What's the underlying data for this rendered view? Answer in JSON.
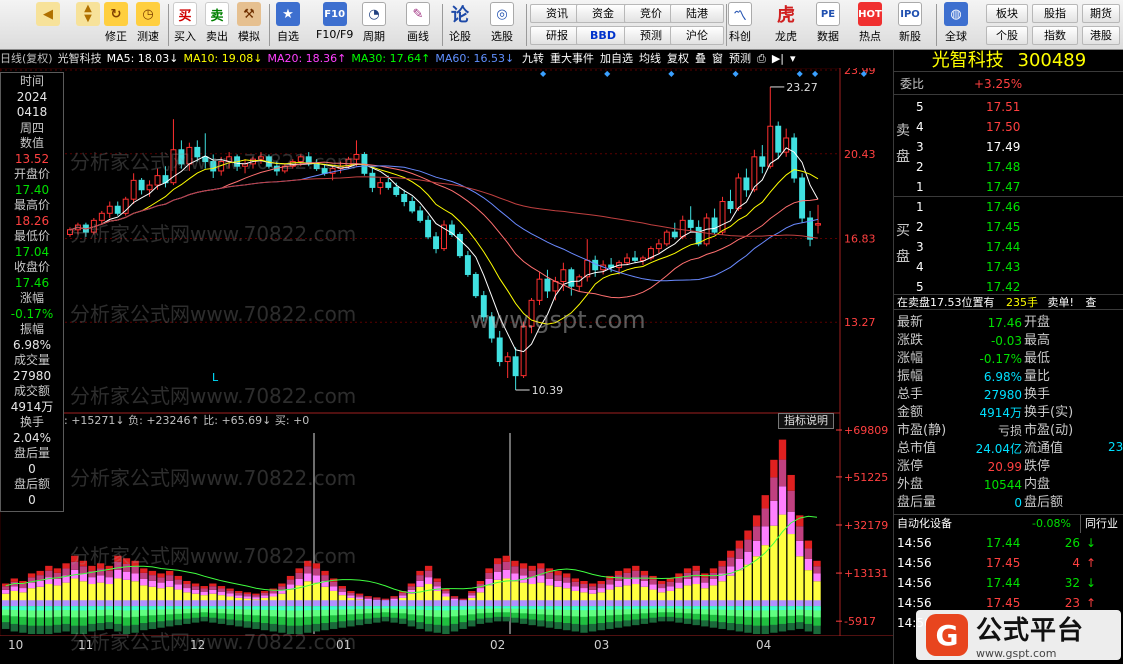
{
  "toolbar": {
    "buttons": [
      {
        "label": "",
        "icon": "back-arrow-icon"
      },
      {
        "label": "",
        "icon": "up-down-arrows-icon"
      },
      {
        "label": "修正",
        "icon": "refresh-icon"
      },
      {
        "label": "测速",
        "icon": "clock-icon"
      },
      {
        "label": "买入",
        "icon": "buy-icon"
      },
      {
        "label": "卖出",
        "icon": "sell-icon"
      },
      {
        "label": "模拟",
        "icon": "hammer-icon"
      },
      {
        "label": "自选",
        "icon": "star-icon"
      },
      {
        "label": "F10/F9",
        "icon": "f10-icon"
      },
      {
        "label": "周期",
        "icon": "period-clock-icon"
      },
      {
        "label": "画线",
        "icon": "pencil-icon"
      },
      {
        "label": "论股",
        "icon": "discuss-icon"
      },
      {
        "label": "选股",
        "icon": "select-stock-icon"
      }
    ],
    "grid_buttons": [
      [
        "资讯",
        "资金",
        "竞价",
        "陆港"
      ],
      [
        "研报",
        "BBD",
        "预测",
        "沪伦"
      ]
    ],
    "right_buttons": [
      {
        "label": "科创",
        "icon": "chart-icon"
      },
      {
        "label": "龙虎",
        "icon": "tiger-icon"
      },
      {
        "label": "数据",
        "icon": "pe-icon"
      },
      {
        "label": "热点",
        "icon": "hot-icon"
      },
      {
        "label": "新股",
        "icon": "new-stock-icon"
      },
      {
        "label": "全球",
        "icon": "globe-icon"
      }
    ],
    "far_right": [
      [
        "板块",
        "股指",
        "期货"
      ],
      [
        "个股",
        "指数",
        "港股"
      ]
    ]
  },
  "header": {
    "chart_mode": "日线(复权)",
    "stock_name": "光智科技",
    "ma5": "MA5: 18.03↓",
    "ma10": "MA10: 19.08↓",
    "ma20": "MA20: 18.36↑",
    "ma30": "MA30: 17.64↑",
    "ma60": "MA60: 16.53↓",
    "tabs": [
      "九转",
      "重大事件",
      "加自选",
      "均线",
      "复权",
      "叠",
      "窗",
      "预测"
    ]
  },
  "left_info": [
    {
      "label": "时间",
      "value": "2024"
    },
    {
      "label": "",
      "value": "0418"
    },
    {
      "label": "周四",
      "value": ""
    },
    {
      "label": "数值",
      "value": "13.52"
    },
    {
      "label": "开盘价",
      "value": "17.40"
    },
    {
      "label": "最高价",
      "value": "18.26"
    },
    {
      "label": "最低价",
      "value": "17.04"
    },
    {
      "label": "收盘价",
      "value": "17.46"
    },
    {
      "label": "涨幅",
      "value": "-0.17%"
    },
    {
      "label": "振幅",
      "value": "6.98%"
    },
    {
      "label": "成交量",
      "value": "27980"
    },
    {
      "label": "成交额",
      "value": "4914万"
    },
    {
      "label": "换手",
      "value": "2.04%"
    },
    {
      "label": "盘后量",
      "value": "0"
    },
    {
      "label": "盘后额",
      "value": "0"
    }
  ],
  "price_axis": [
    "23.99",
    "20.43",
    "16.83",
    "13.27"
  ],
  "annotations": {
    "high": "23.27",
    "low": "10.39",
    "marker": "L"
  },
  "indicator": {
    "header": ": +15271↓ 负: +23246↑ 比: +65.69↓ 买: +0",
    "button": "指标说明",
    "axis": [
      "+69809",
      "+51225",
      "+32179",
      "+13131",
      "-5917"
    ]
  },
  "month_axis": [
    "10",
    "11",
    "12",
    "01",
    "02",
    "03",
    "04"
  ],
  "right_panel": {
    "title": "光智科技",
    "code": "300489",
    "weibi_label": "委比",
    "weibi_value": "+3.25%",
    "sell_label": "卖盘",
    "buy_label": "买盘",
    "sells": [
      {
        "level": "5",
        "price": "17.51"
      },
      {
        "level": "4",
        "price": "17.50"
      },
      {
        "level": "3",
        "price": "17.49"
      },
      {
        "level": "2",
        "price": "17.48"
      },
      {
        "level": "1",
        "price": "17.47"
      }
    ],
    "buys": [
      {
        "level": "1",
        "price": "17.46"
      },
      {
        "level": "2",
        "price": "17.45"
      },
      {
        "level": "3",
        "price": "17.44"
      },
      {
        "level": "4",
        "price": "17.43"
      },
      {
        "level": "5",
        "price": "17.42"
      }
    ],
    "info_bar": "在卖盘17.53位置有",
    "info_bar_qty": "235手",
    "info_bar_btn": "卖单!",
    "info_bar_btn2": "查",
    "stats_left": [
      {
        "label": "最新",
        "value": "17.46"
      },
      {
        "label": "涨跌",
        "value": "-0.03"
      },
      {
        "label": "涨幅",
        "value": "-0.17%"
      },
      {
        "label": "振幅",
        "value": "6.98%"
      },
      {
        "label": "总手",
        "value": "27980"
      },
      {
        "label": "金额",
        "value": "4914万"
      },
      {
        "label": "市盈(静)",
        "value": "亏损"
      },
      {
        "label": "总市值",
        "value": "24.04亿"
      },
      {
        "label": "涨停",
        "value": "20.99"
      },
      {
        "label": "外盘",
        "value": "10544"
      },
      {
        "label": "盘后量",
        "value": "0"
      }
    ],
    "stats_right": [
      "开盘",
      "最高",
      "最低",
      "量比",
      "换手",
      "换手(实)",
      "市盈(动)",
      "流通值",
      "跌停",
      "内盘",
      "盘后额"
    ],
    "stats_right_extra": "23",
    "sector": "自动化设备",
    "sector_change": "-0.08%",
    "sector_btn": "同行业",
    "ticks": [
      {
        "time": "14:56",
        "price": "17.44",
        "vol": "26",
        "dir": "down"
      },
      {
        "time": "14:56",
        "price": "17.45",
        "vol": "4",
        "dir": "up"
      },
      {
        "time": "14:56",
        "price": "17.44",
        "vol": "32",
        "dir": "down"
      },
      {
        "time": "14:56",
        "price": "17.45",
        "vol": "23",
        "dir": "up"
      },
      {
        "time": "14:56",
        "price": "",
        "vol": "",
        "dir": ""
      }
    ]
  },
  "watermarks": {
    "site": "分析家公式网www.70822.com",
    "url": "www.gspt.com"
  },
  "logo": {
    "big": "公式平台",
    "small": "www.gspt.com"
  },
  "colors": {
    "up": "#ff3030",
    "down": "#40e0e0",
    "ma5": "#ffffff",
    "ma10": "#ffff00",
    "ma20": "#ff40ff",
    "ma30": "#00ff00",
    "ma60": "#6090ff"
  },
  "chart_data": {
    "type": "candlestick",
    "ylim": [
      10.39,
      23.99
    ],
    "candles": [
      [
        17.0,
        17.3,
        16.9,
        17.2
      ],
      [
        17.2,
        17.5,
        17.0,
        17.4
      ],
      [
        17.4,
        17.5,
        16.9,
        17.1
      ],
      [
        17.1,
        17.7,
        17.0,
        17.6
      ],
      [
        17.6,
        18.0,
        17.4,
        17.9
      ],
      [
        17.9,
        18.4,
        17.7,
        18.2
      ],
      [
        18.2,
        18.4,
        17.8,
        17.9
      ],
      [
        17.9,
        18.6,
        17.8,
        18.5
      ],
      [
        18.5,
        19.6,
        18.3,
        19.3
      ],
      [
        19.3,
        19.4,
        18.7,
        18.9
      ],
      [
        18.9,
        19.3,
        18.6,
        19.1
      ],
      [
        19.1,
        19.8,
        18.9,
        19.5
      ],
      [
        19.5,
        19.9,
        19.0,
        19.2
      ],
      [
        19.2,
        21.9,
        19.1,
        20.6
      ],
      [
        20.6,
        21.0,
        19.8,
        20.0
      ],
      [
        20.0,
        20.9,
        19.7,
        20.7
      ],
      [
        20.7,
        21.0,
        20.1,
        20.3
      ],
      [
        20.3,
        21.3,
        19.8,
        20.1
      ],
      [
        20.1,
        20.4,
        19.4,
        19.7
      ],
      [
        19.7,
        20.3,
        19.5,
        20.1
      ],
      [
        20.1,
        20.5,
        19.8,
        20.3
      ],
      [
        20.3,
        20.4,
        19.7,
        19.9
      ],
      [
        19.9,
        20.2,
        19.6,
        20.0
      ],
      [
        20.0,
        20.3,
        19.8,
        20.2
      ],
      [
        20.2,
        20.5,
        20.0,
        20.3
      ],
      [
        20.3,
        20.4,
        19.8,
        19.9
      ],
      [
        19.9,
        20.1,
        19.5,
        19.7
      ],
      [
        19.7,
        20.0,
        19.6,
        19.9
      ],
      [
        19.9,
        20.2,
        19.8,
        20.1
      ],
      [
        20.1,
        20.4,
        19.9,
        20.3
      ],
      [
        20.3,
        20.5,
        19.9,
        20.0
      ],
      [
        20.0,
        20.2,
        19.7,
        19.8
      ],
      [
        19.8,
        20.0,
        19.5,
        19.6
      ],
      [
        19.6,
        19.9,
        19.3,
        19.8
      ],
      [
        19.8,
        20.1,
        19.6,
        19.9
      ],
      [
        19.9,
        20.3,
        19.8,
        20.2
      ],
      [
        20.2,
        21.0,
        19.9,
        20.4
      ],
      [
        20.4,
        20.5,
        19.5,
        19.6
      ],
      [
        19.6,
        19.8,
        18.8,
        19.0
      ],
      [
        19.0,
        19.4,
        18.7,
        19.2
      ],
      [
        19.2,
        19.5,
        18.9,
        19.0
      ],
      [
        19.0,
        19.2,
        18.6,
        18.7
      ],
      [
        18.7,
        18.9,
        18.2,
        18.4
      ],
      [
        18.4,
        18.6,
        17.9,
        18.0
      ],
      [
        18.0,
        18.2,
        17.5,
        17.6
      ],
      [
        17.6,
        17.8,
        16.8,
        16.9
      ],
      [
        16.9,
        17.1,
        16.2,
        16.4
      ],
      [
        16.4,
        17.6,
        16.3,
        17.4
      ],
      [
        17.4,
        17.6,
        16.9,
        17.0
      ],
      [
        17.0,
        17.1,
        16.0,
        16.1
      ],
      [
        16.1,
        16.3,
        15.2,
        15.3
      ],
      [
        15.3,
        15.4,
        14.3,
        14.4
      ],
      [
        14.4,
        14.6,
        13.3,
        13.5
      ],
      [
        13.5,
        13.7,
        12.4,
        12.6
      ],
      [
        12.6,
        12.9,
        11.4,
        11.6
      ],
      [
        11.6,
        12.0,
        10.9,
        11.8
      ],
      [
        11.8,
        12.2,
        10.39,
        11.0
      ],
      [
        11.0,
        13.3,
        10.9,
        13.1
      ],
      [
        13.1,
        14.3,
        12.8,
        14.2
      ],
      [
        14.2,
        15.4,
        14.0,
        15.1
      ],
      [
        15.1,
        15.5,
        14.3,
        14.6
      ],
      [
        14.6,
        15.2,
        14.2,
        15.0
      ],
      [
        15.0,
        15.8,
        14.6,
        15.5
      ],
      [
        15.5,
        15.6,
        14.4,
        14.8
      ],
      [
        14.8,
        15.3,
        14.6,
        15.2
      ],
      [
        15.2,
        16.8,
        15.0,
        15.9
      ],
      [
        15.9,
        16.1,
        15.2,
        15.5
      ],
      [
        15.5,
        15.9,
        15.3,
        15.7
      ],
      [
        15.7,
        16.0,
        15.4,
        15.6
      ],
      [
        15.6,
        15.9,
        15.3,
        15.8
      ],
      [
        15.8,
        16.2,
        15.7,
        16.0
      ],
      [
        16.0,
        16.3,
        15.8,
        15.9
      ],
      [
        15.9,
        16.1,
        15.7,
        16.0
      ],
      [
        16.0,
        16.5,
        15.9,
        16.4
      ],
      [
        16.4,
        16.8,
        16.2,
        16.6
      ],
      [
        16.6,
        17.2,
        16.5,
        17.1
      ],
      [
        17.1,
        17.5,
        16.8,
        16.9
      ],
      [
        16.9,
        17.8,
        16.8,
        17.6
      ],
      [
        17.6,
        18.2,
        17.1,
        17.3
      ],
      [
        17.3,
        17.6,
        16.5,
        16.6
      ],
      [
        16.6,
        17.9,
        16.5,
        17.7
      ],
      [
        17.7,
        18.1,
        17.0,
        17.1
      ],
      [
        17.1,
        18.6,
        17.0,
        18.4
      ],
      [
        18.4,
        18.9,
        17.9,
        18.1
      ],
      [
        18.1,
        19.6,
        18.0,
        19.4
      ],
      [
        19.4,
        19.8,
        18.6,
        18.9
      ],
      [
        18.9,
        20.6,
        18.8,
        20.3
      ],
      [
        20.3,
        20.8,
        19.6,
        19.9
      ],
      [
        19.9,
        23.27,
        19.8,
        21.6
      ],
      [
        21.6,
        21.8,
        20.2,
        20.5
      ],
      [
        20.5,
        21.5,
        20.3,
        21.1
      ],
      [
        21.1,
        21.3,
        19.2,
        19.4
      ],
      [
        19.4,
        19.6,
        17.5,
        17.7
      ],
      [
        17.7,
        18.0,
        16.5,
        16.8
      ],
      [
        17.4,
        18.26,
        17.04,
        17.46
      ]
    ],
    "volume": {
      "ylim": [
        -11000,
        69809
      ],
      "pos": [
        9000,
        11000,
        10000,
        13000,
        14000,
        16000,
        15000,
        17000,
        20000,
        18000,
        16000,
        17000,
        16000,
        20000,
        19000,
        18000,
        15000,
        14000,
        13000,
        14000,
        12000,
        10000,
        9000,
        8000,
        9000,
        8000,
        7000,
        6000,
        5500,
        5000,
        6000,
        7000,
        9000,
        12000,
        15000,
        18000,
        17000,
        14000,
        11000,
        8000,
        6000,
        5000,
        4000,
        3500,
        3000,
        4000,
        6000,
        9000,
        14000,
        16000,
        11000,
        7000,
        4000,
        3000,
        6000,
        10000,
        15000,
        19000,
        20000,
        18000,
        17000,
        16000,
        17000,
        15000,
        14000,
        13000,
        11000,
        10000,
        9000,
        10000,
        12000,
        14000,
        15000,
        16000,
        14000,
        12000,
        10000,
        11000,
        13000,
        15000,
        16000,
        13000,
        15000,
        18000,
        22000,
        26000,
        30000,
        36000,
        44000,
        58000,
        66000,
        52000,
        36000,
        26000,
        18000
      ],
      "neg": [
        -9000,
        -10000,
        -10500,
        -11000,
        -11000,
        -11000,
        -10500,
        -10000,
        -11000,
        -11000,
        -10000,
        -9500,
        -9000,
        -10000,
        -11000,
        -10500,
        -9500,
        -9000,
        -8500,
        -8000,
        -7500,
        -7000,
        -6500,
        -6000,
        -6500,
        -7000,
        -7500,
        -8000,
        -8500,
        -9000,
        -9500,
        -10000,
        -10500,
        -11000,
        -11000,
        -10500,
        -10000,
        -9500,
        -9000,
        -8500,
        -8000,
        -7500,
        -7000,
        -6500,
        -6000,
        -6500,
        -7000,
        -8000,
        -9000,
        -10000,
        -10500,
        -11000,
        -10000,
        -9000,
        -8000,
        -7000,
        -6500,
        -6000,
        -6000,
        -6500,
        -7000,
        -7500,
        -8000,
        -8500,
        -9000,
        -9500,
        -10000,
        -10500,
        -10000,
        -9500,
        -9000,
        -8500,
        -8000,
        -7500,
        -7000,
        -6500,
        -6000,
        -6000,
        -6500,
        -7000,
        -7500,
        -8000,
        -8500,
        -9000,
        -9500,
        -10000,
        -10500,
        -11000,
        -11000,
        -10500,
        -10000,
        -9500,
        -9000,
        -10000,
        -11000
      ]
    }
  }
}
